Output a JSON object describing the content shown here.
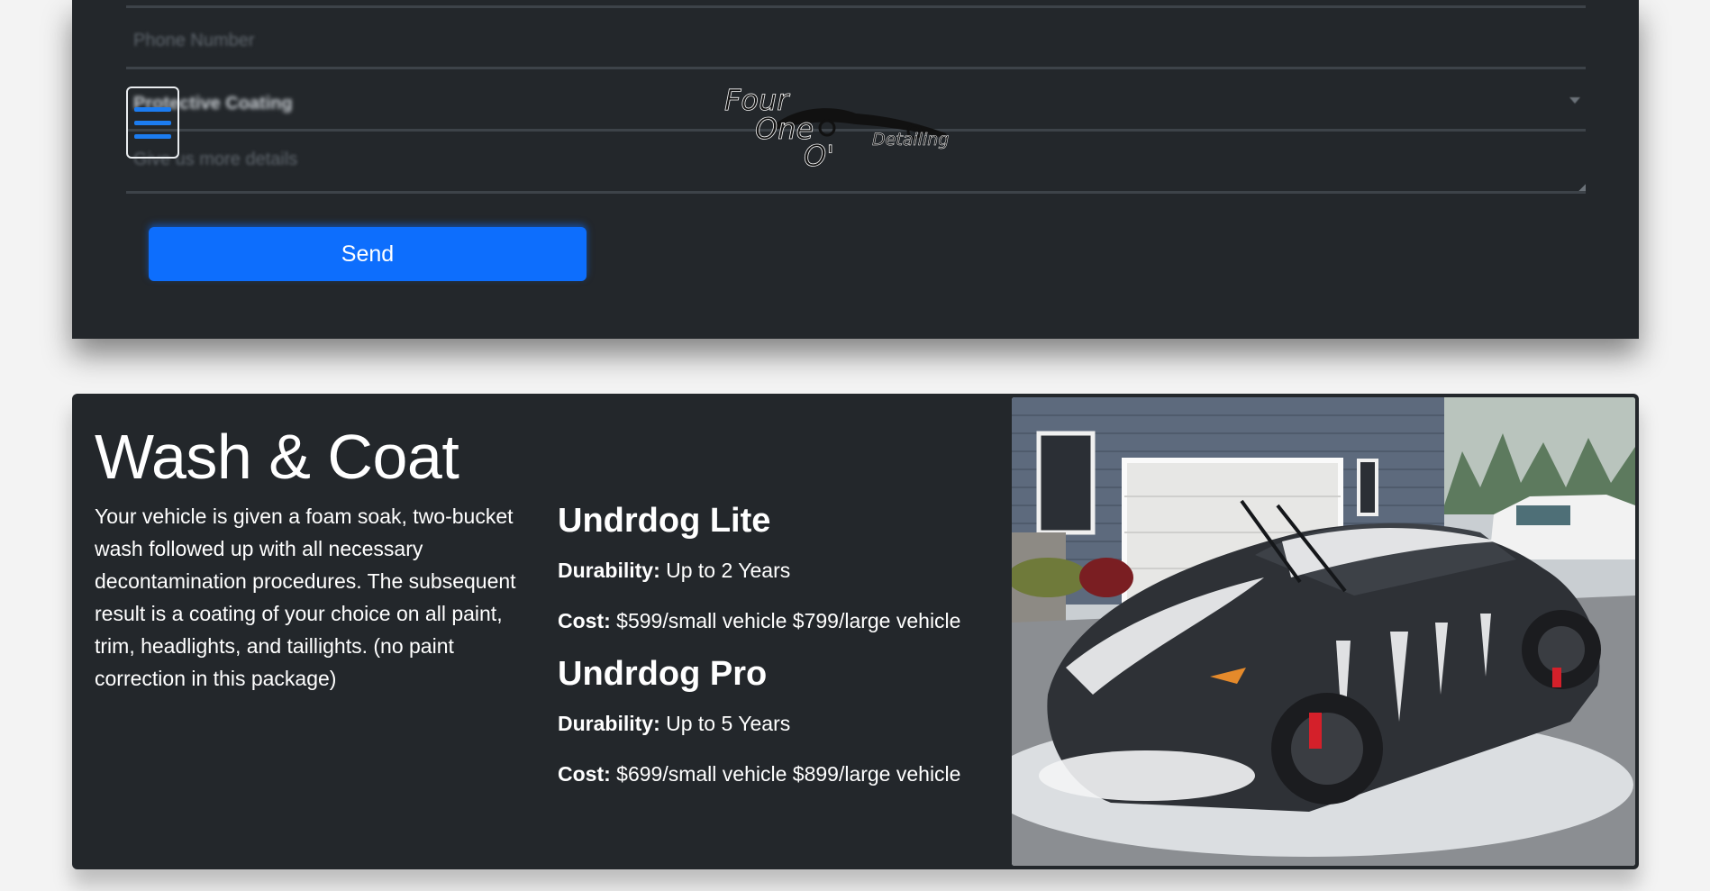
{
  "contact_form": {
    "phone_placeholder": "Phone Number",
    "service_select_value": "Protective Coating",
    "details_placeholder": "Give us more details",
    "send_label": "Send",
    "accent_color": "#0d6efd"
  },
  "header": {
    "menu_icon": "hamburger-menu-icon",
    "logo": {
      "line1": "Four",
      "line2": "One",
      "line3": "O'",
      "tagline": "Detailing"
    }
  },
  "service": {
    "title": "Wash & Coat",
    "description": "Your vehicle is given a foam soak, two-bucket wash followed up with all necessary decontamination procedures. The subsequent result is a coating of your choice on all paint, trim, headlights, and taillights. (no paint correction in this package)",
    "tiers": [
      {
        "name": "Undrdog Lite",
        "durability_label": "Durability:",
        "durability_value": "Up to 2 Years",
        "cost_label": "Cost:",
        "cost_value": "$599/small vehicle $799/large vehicle"
      },
      {
        "name": "Undrdog Pro",
        "durability_label": "Durability:",
        "durability_value": "Up to 5 Years",
        "cost_label": "Cost:",
        "cost_value": "$699/small vehicle $899/large vehicle"
      }
    ],
    "image_subject": "foam-covered-black-sports-car-photo"
  }
}
